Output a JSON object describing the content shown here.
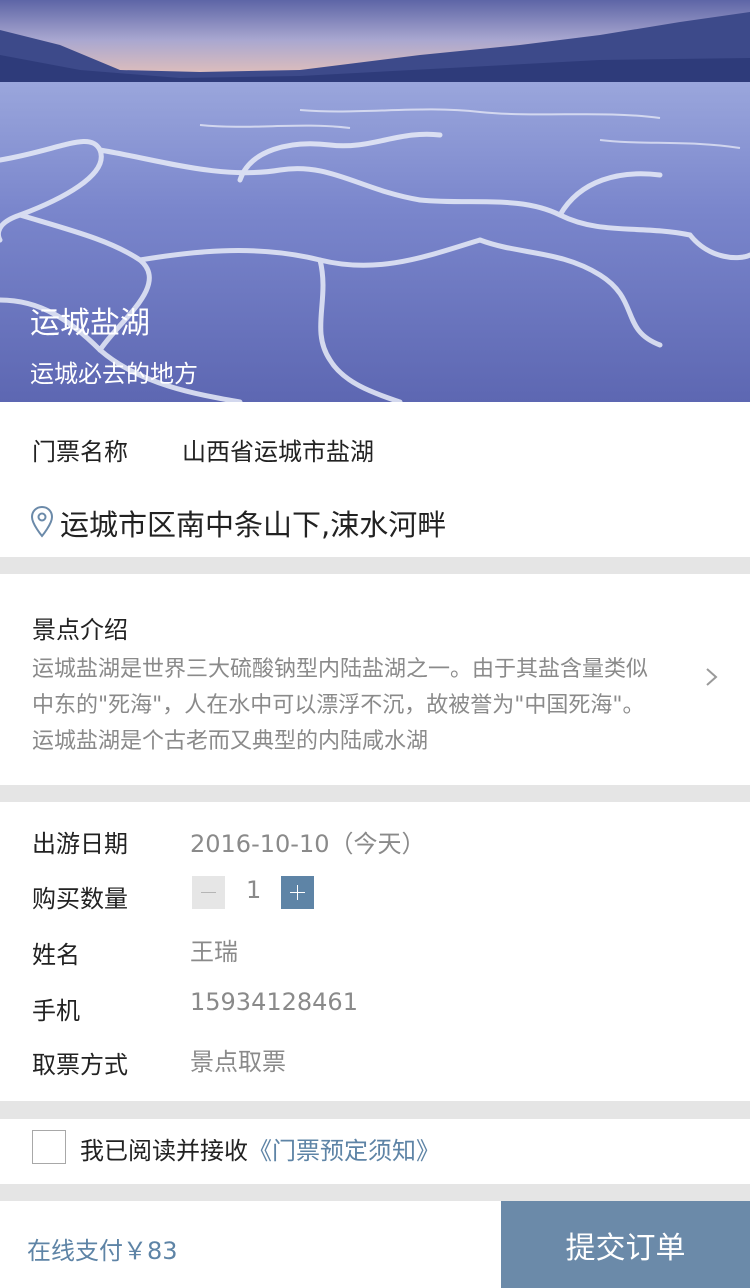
{
  "hero": {
    "title": "运城盐湖",
    "subtitle": "运城必去的地方"
  },
  "ticket": {
    "label": "门票名称",
    "value": "山西省运城市盐湖",
    "location_icon": "location-pin-icon",
    "location": "运城市区南中条山下,涑水河畔"
  },
  "intro": {
    "title": "景点介绍",
    "lines": [
      "运城盐湖是世界三大硫酸钠型内陆盐湖之一。由于其盐含量类似",
      "中东的\"死海\"，人在水中可以漂浮不沉，故被誉为\"中国死海\"。",
      "运城盐湖是个古老而又典型的内陆咸水湖"
    ],
    "chevron_icon": "chevron-right-icon"
  },
  "form": {
    "date_label": "出游日期",
    "date_value": "2016-10-10（今天）",
    "qty_label": "购买数量",
    "qty_value": "1",
    "name_label": "姓名",
    "name_value": "王瑞",
    "phone_label": "手机",
    "phone_value": "15934128461",
    "pickup_label": "取票方式",
    "pickup_value": "景点取票"
  },
  "agree": {
    "prefix": "我已阅读并接收",
    "link": "《门票预定须知》"
  },
  "bottom": {
    "pay_text": "在线支付￥83",
    "submit_label": "提交订单"
  },
  "colors": {
    "accent": "#5e84a6",
    "submit_bg": "#6b8aa9",
    "muted_text": "#8a8a8a",
    "divider": "#e5e5e5"
  }
}
